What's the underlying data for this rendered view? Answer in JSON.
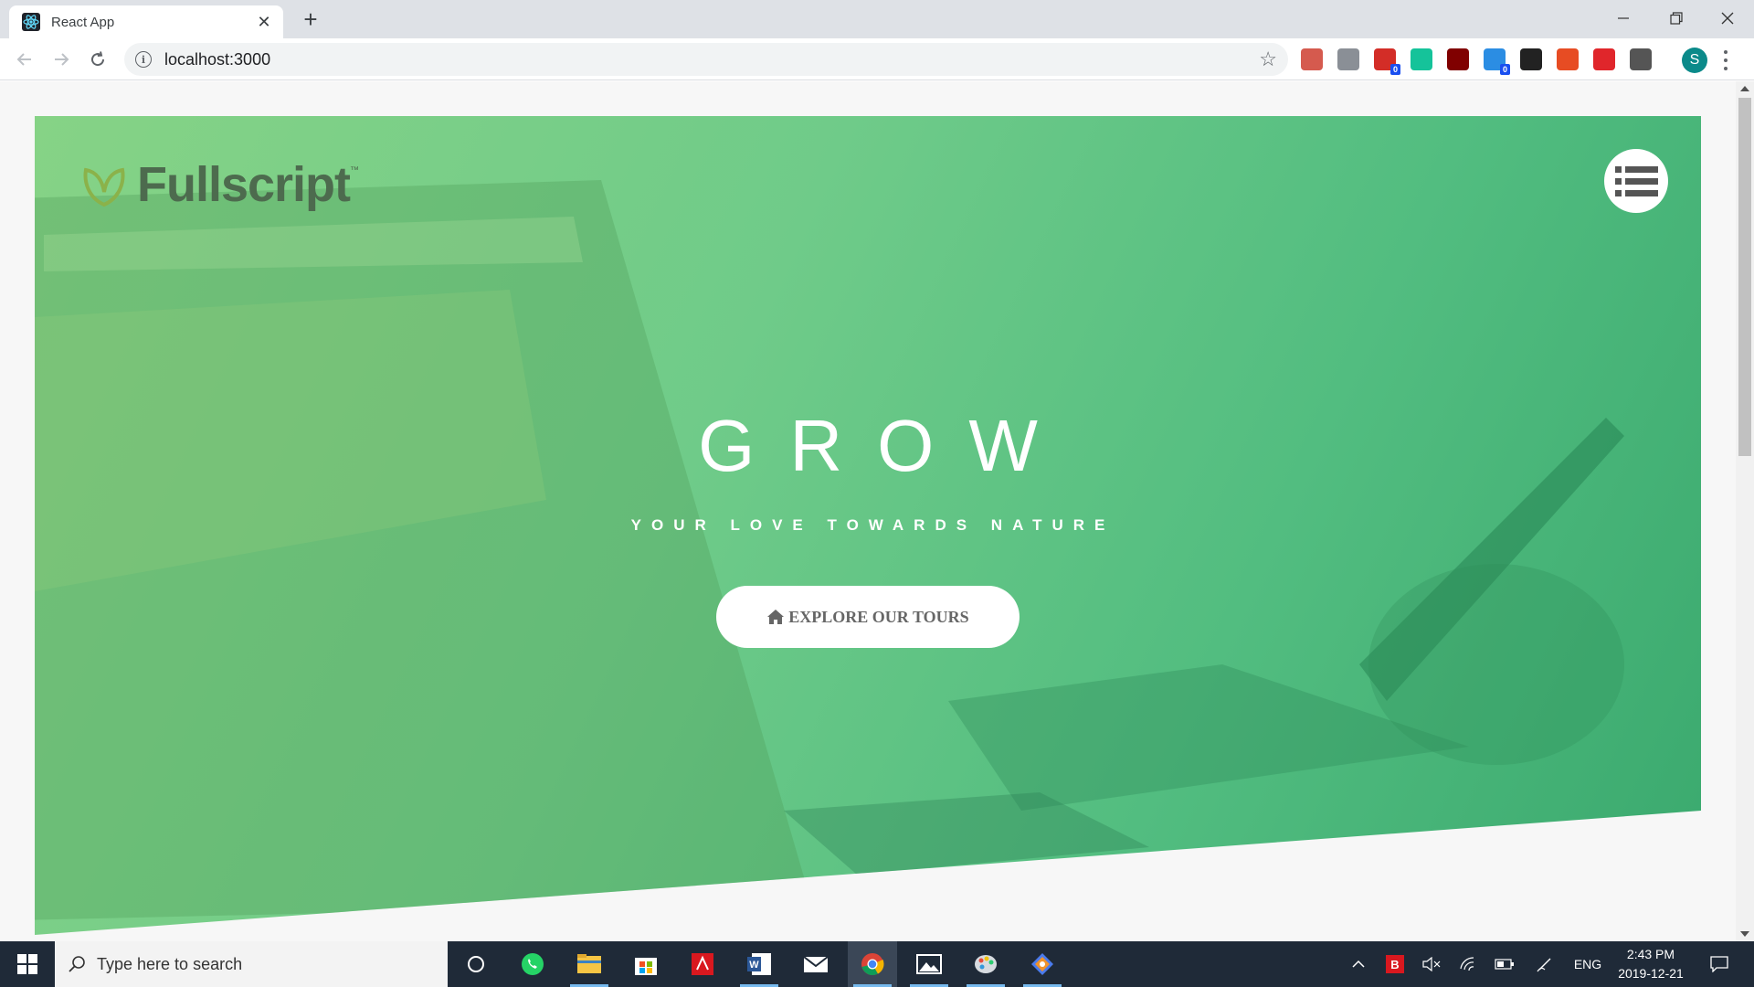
{
  "browser": {
    "tab_title": "React App",
    "new_tab_symbol": "+",
    "tab_close_symbol": "✕",
    "url": "localhost:3000",
    "extensions": [
      {
        "name": "pdf-extension-icon",
        "color": "#d55a4e"
      },
      {
        "name": "translate-extension-icon",
        "color": "#8a8f96"
      },
      {
        "name": "lastpass-extension-icon",
        "color": "#d32d27",
        "badge": "0"
      },
      {
        "name": "grammarly-extension-icon",
        "color": "#15c39a"
      },
      {
        "name": "ublock-extension-icon",
        "color": "#800000"
      },
      {
        "name": "honey-extension-icon",
        "color": "#2b8de3",
        "badge": "0"
      },
      {
        "name": "pocket-extension-icon",
        "color": "#222222"
      },
      {
        "name": "office-extension-icon",
        "color": "#e74c23"
      },
      {
        "name": "pdf-converter-extension-icon",
        "color": "#e0262b"
      },
      {
        "name": "json-viewer-extension-icon",
        "color": "#555555"
      }
    ],
    "profile_initial": "S"
  },
  "hero": {
    "logo_text": "Fullscript",
    "logo_tm": "™",
    "title": "GROW",
    "subtitle": "YOUR LOVE TOWARDS NATURE",
    "cta_label": "EXPLORE OUR TOURS"
  },
  "taskbar": {
    "search_placeholder": "Type here to search",
    "apps": [
      "cortana",
      "whatsapp",
      "file-explorer",
      "microsoft-store",
      "acrobat",
      "word",
      "mail",
      "chrome",
      "photos",
      "paint-3d",
      "git"
    ],
    "tray_lang": "ENG",
    "time": "2:43 PM",
    "date": "2019-12-21"
  },
  "colors": {
    "hero_green_light": "#86d386",
    "hero_green_dark": "#3aa96e",
    "taskbar_bg": "#1f2a38"
  }
}
